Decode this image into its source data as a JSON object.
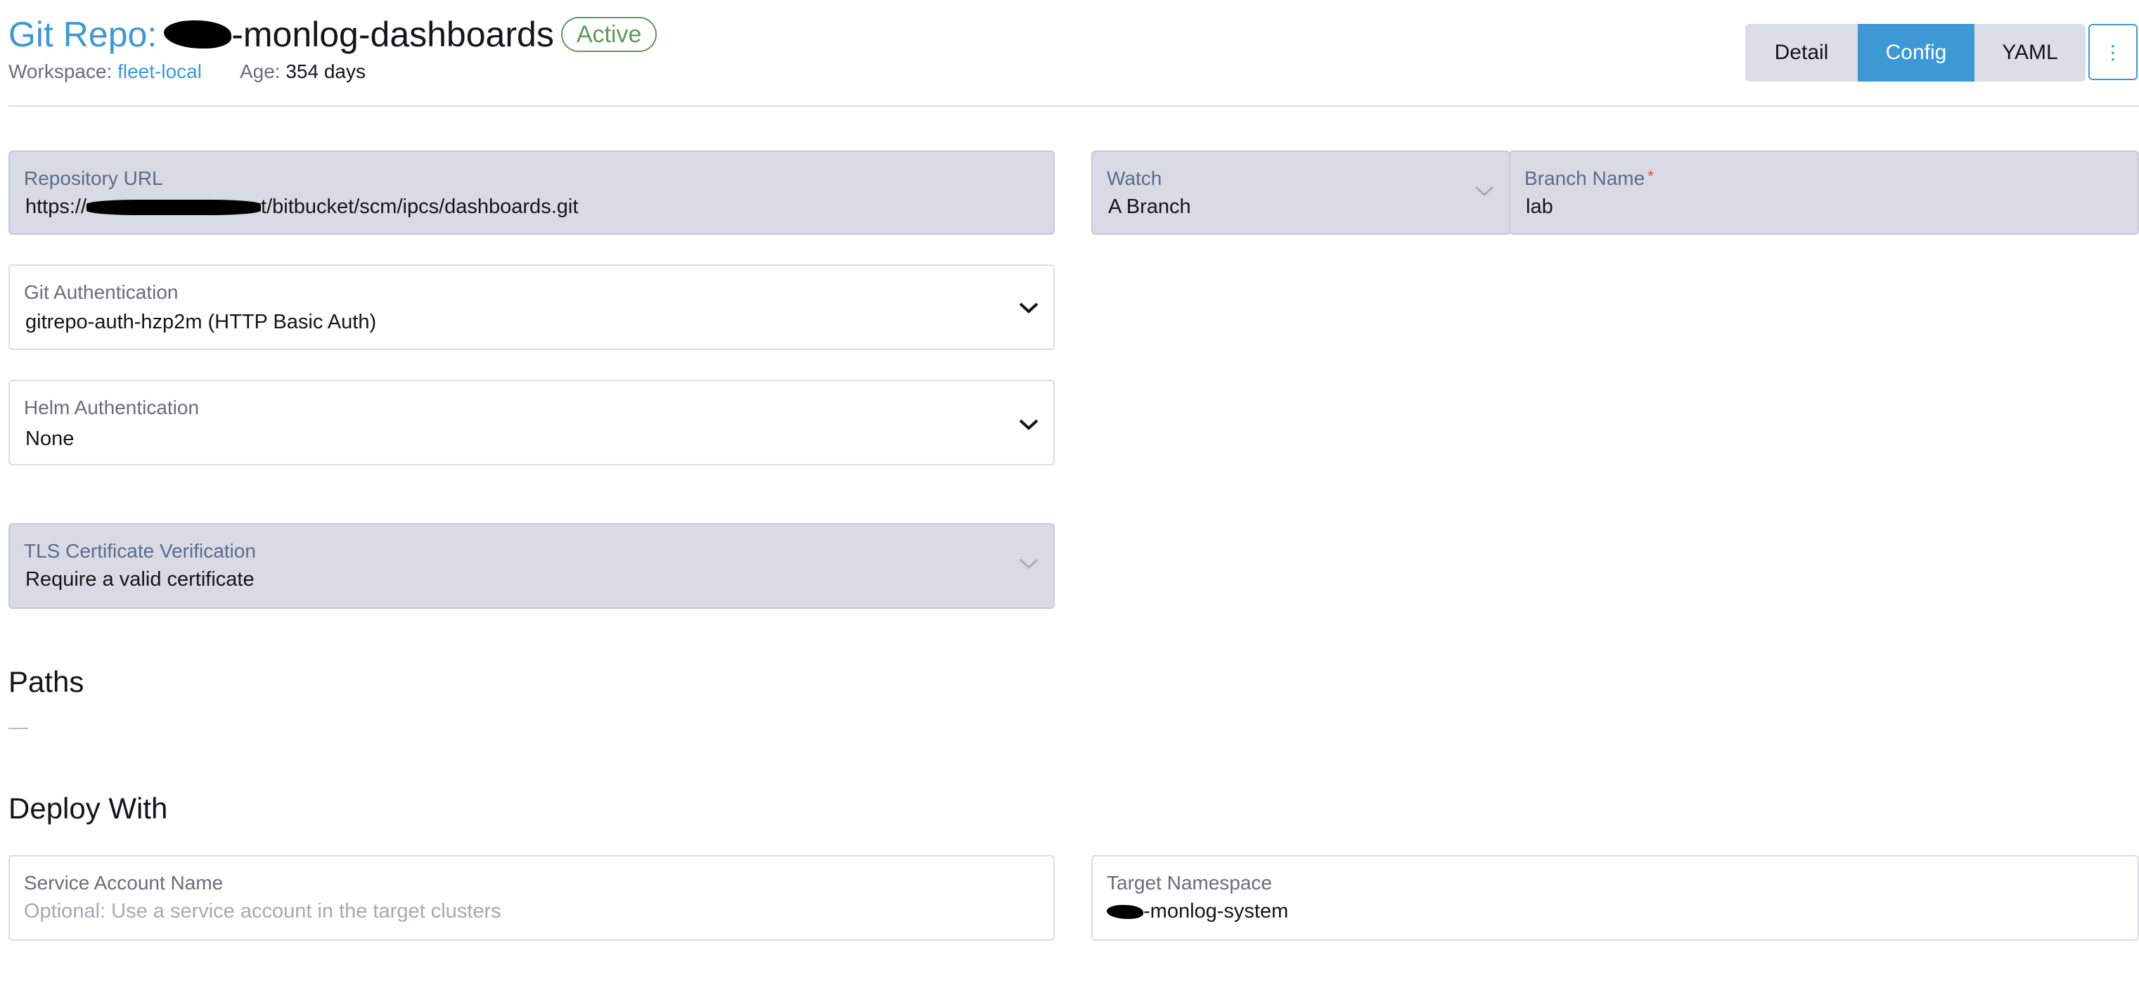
{
  "header": {
    "title_prefix": "Git Repo:",
    "title_name": "-monlog-dashboards",
    "status": "Active",
    "workspace_label": "Workspace:",
    "workspace_value": "fleet-local",
    "age_label": "Age:",
    "age_value": "354 days"
  },
  "view_tabs": [
    {
      "label": "Detail",
      "active": false
    },
    {
      "label": "Config",
      "active": true
    },
    {
      "label": "YAML",
      "active": false
    }
  ],
  "more_button": "⋮",
  "form": {
    "repo_url": {
      "label": "Repository URL",
      "value_prefix": "https://",
      "value_suffix": "t/bitbucket/scm/ipcs/dashboards.git"
    },
    "watch": {
      "label": "Watch",
      "value": "A Branch"
    },
    "branch": {
      "label": "Branch Name",
      "required_mark": "*",
      "value": "lab"
    },
    "git_auth": {
      "label": "Git Authentication",
      "value": "gitrepo-auth-hzp2m (HTTP Basic Auth)"
    },
    "helm_auth": {
      "label": "Helm Authentication",
      "value": "None"
    },
    "tls": {
      "label": "TLS Certificate Verification",
      "value": "Require a valid certificate"
    }
  },
  "paths": {
    "title": "Paths",
    "empty": "—"
  },
  "deploy": {
    "title": "Deploy With",
    "service_account": {
      "label": "Service Account Name",
      "placeholder": "Optional: Use a service account in the target clusters"
    },
    "target_namespace": {
      "label": "Target Namespace",
      "value_suffix": "-monlog-system"
    }
  },
  "colors": {
    "accent": "#3d98d3",
    "active_badge": "#5d995d",
    "disabled_field": "#d8dbe6",
    "required": "#e0453f"
  },
  "icons": {
    "dropdown": "chevron-down-icon",
    "more": "kebab-menu-icon"
  }
}
